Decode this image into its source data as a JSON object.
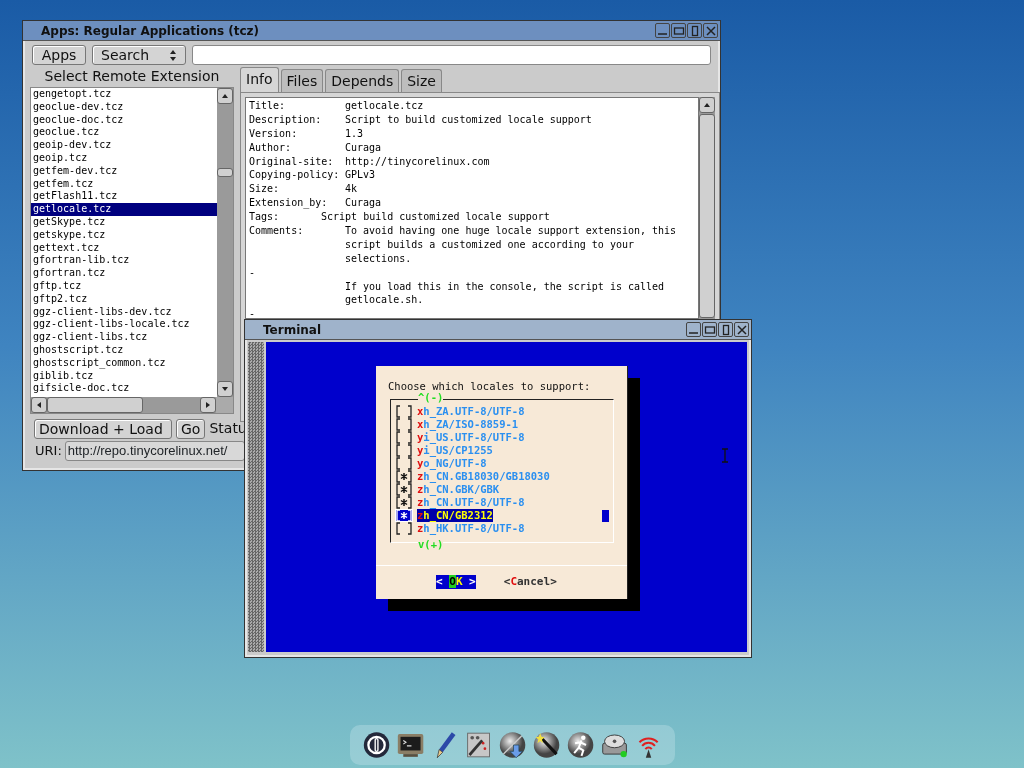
{
  "apps_window": {
    "title": "Apps: Regular Applications (tcz)",
    "apps_button": "Apps",
    "search_select": "Search",
    "list_heading": "Select Remote Extension",
    "extensions": [
      {
        "name": "gengetopt.tcz",
        "selected": false
      },
      {
        "name": "geoclue-dev.tcz",
        "selected": false
      },
      {
        "name": "geoclue-doc.tcz",
        "selected": false
      },
      {
        "name": "geoclue.tcz",
        "selected": false
      },
      {
        "name": "geoip-dev.tcz",
        "selected": false
      },
      {
        "name": "geoip.tcz",
        "selected": false
      },
      {
        "name": "getfem-dev.tcz",
        "selected": false
      },
      {
        "name": "getfem.tcz",
        "selected": false
      },
      {
        "name": "getFlash11.tcz",
        "selected": false
      },
      {
        "name": "getlocale.tcz",
        "selected": true
      },
      {
        "name": "getSkype.tcz",
        "selected": false
      },
      {
        "name": "getskype.tcz",
        "selected": false
      },
      {
        "name": "gettext.tcz",
        "selected": false
      },
      {
        "name": "gfortran-lib.tcz",
        "selected": false
      },
      {
        "name": "gfortran.tcz",
        "selected": false
      },
      {
        "name": "gftp.tcz",
        "selected": false
      },
      {
        "name": "gftp2.tcz",
        "selected": false
      },
      {
        "name": "ggz-client-libs-dev.tcz",
        "selected": false
      },
      {
        "name": "ggz-client-libs-locale.tcz",
        "selected": false
      },
      {
        "name": "ggz-client-libs.tcz",
        "selected": false
      },
      {
        "name": "ghostscript.tcz",
        "selected": false
      },
      {
        "name": "ghostscript_common.tcz",
        "selected": false
      },
      {
        "name": "giblib.tcz",
        "selected": false
      },
      {
        "name": "gifsicle-doc.tcz",
        "selected": false
      }
    ],
    "action_select": "Download + Load",
    "go_button": "Go",
    "status_label": "Statu",
    "uri_label": "URI:",
    "uri_value": "http://repo.tinycorelinux.net/",
    "tabs": [
      {
        "label": "Info",
        "selected": true
      },
      {
        "label": "Files",
        "selected": false
      },
      {
        "label": "Depends",
        "selected": false
      },
      {
        "label": "Size",
        "selected": false
      }
    ],
    "info_lines": [
      {
        "kind": "field",
        "key": "Title:",
        "value": "getlocale.tcz"
      },
      {
        "kind": "field",
        "key": "Description:",
        "value": "Script to build customized locale support"
      },
      {
        "kind": "field",
        "key": "Version:",
        "value": "1.3"
      },
      {
        "kind": "field",
        "key": "Author:",
        "value": "Curaga"
      },
      {
        "kind": "field",
        "key": "Original-site:",
        "value": "http://tinycorelinux.com"
      },
      {
        "kind": "field",
        "key": "Copying-policy:",
        "value": "GPLv3"
      },
      {
        "kind": "field",
        "key": "Size:",
        "value": "4k"
      },
      {
        "kind": "field",
        "key": "Extension_by:",
        "value": "Curaga"
      },
      {
        "kind": "tags",
        "key": "Tags:",
        "value": "Script build customized locale support"
      },
      {
        "kind": "field",
        "key": "Comments:",
        "value": "To avoid having one huge locale support extension, this"
      },
      {
        "kind": "cont",
        "value": "script builds a customized one according to your"
      },
      {
        "kind": "cont",
        "value": "selections."
      },
      {
        "kind": "dash",
        "value": "-"
      },
      {
        "kind": "cont",
        "value": "If you load this in the console, the script is called"
      },
      {
        "kind": "cont",
        "value": "getlocale.sh."
      },
      {
        "kind": "dash",
        "value": "-"
      }
    ]
  },
  "terminal": {
    "title": "Terminal",
    "dialog": {
      "prompt": "Choose which locales to support:",
      "scroll_up": "^(-)",
      "scroll_down": "v(+)",
      "items": [
        {
          "hotkey": "x",
          "rest": "h_ZA.UTF-8/UTF-8",
          "checked": false,
          "selected": false
        },
        {
          "hotkey": "x",
          "rest": "h_ZA/ISO-8859-1",
          "checked": false,
          "selected": false
        },
        {
          "hotkey": "y",
          "rest": "i_US.UTF-8/UTF-8",
          "checked": false,
          "selected": false
        },
        {
          "hotkey": "y",
          "rest": "i_US/CP1255",
          "checked": false,
          "selected": false
        },
        {
          "hotkey": "y",
          "rest": "o_NG/UTF-8",
          "checked": false,
          "selected": false
        },
        {
          "hotkey": "z",
          "rest": "h_CN.GB18030/GB18030",
          "checked": true,
          "selected": false
        },
        {
          "hotkey": "z",
          "rest": "h_CN.GBK/GBK",
          "checked": true,
          "selected": false
        },
        {
          "hotkey": "z",
          "rest": "h_CN.UTF-8/UTF-8",
          "checked": true,
          "selected": false
        },
        {
          "hotkey": "z",
          "rest": "h_CN/GB2312",
          "checked": true,
          "selected": true
        },
        {
          "hotkey": "z",
          "rest": "h_HK.UTF-8/UTF-8",
          "checked": false,
          "selected": false
        }
      ],
      "buttons": [
        {
          "open": "< ",
          "hotkey": "O",
          "rest": "K",
          "close": " >",
          "selected": true
        },
        {
          "open": "<",
          "hotkey": "C",
          "rest": "ancel",
          "close": ">",
          "selected": false
        }
      ]
    }
  }
}
